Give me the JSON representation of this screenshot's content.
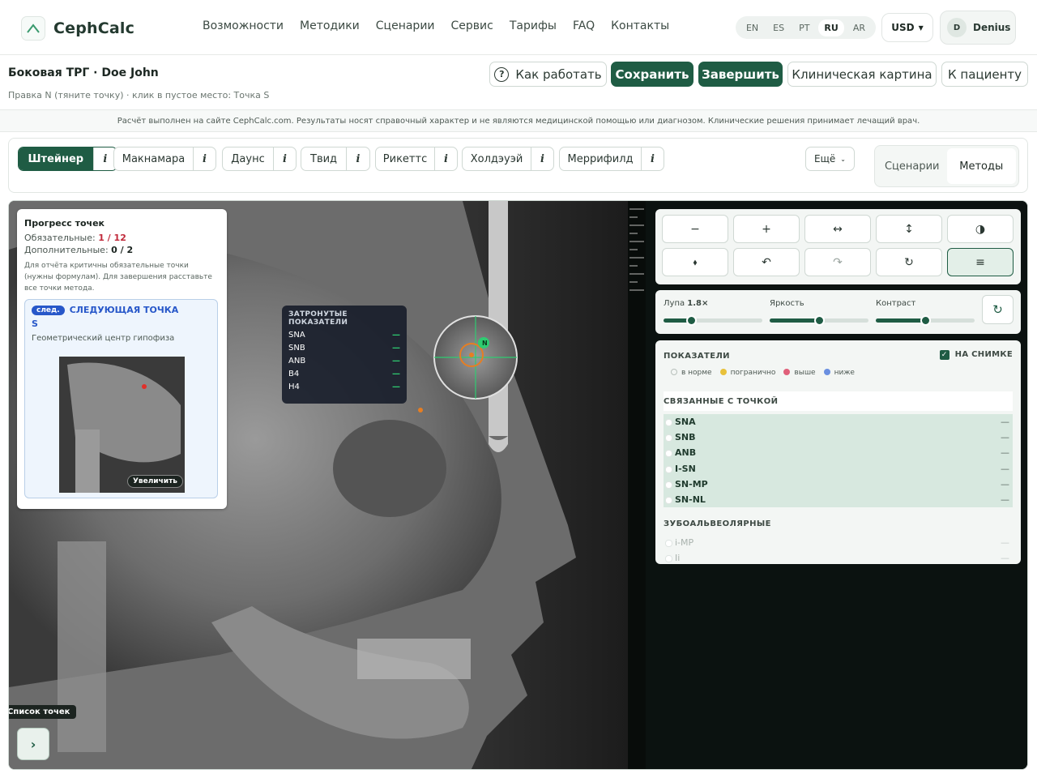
{
  "nav": {
    "brand": "CephCalc",
    "links": [
      "Возможности",
      "Методики",
      "Сценарии",
      "Сервис",
      "Тарифы",
      "FAQ",
      "Контакты"
    ],
    "languages": [
      "EN",
      "ES",
      "PT",
      "RU",
      "AR"
    ],
    "active_language": "RU",
    "currency": "USD",
    "user_initial": "D",
    "user_name": "Denius"
  },
  "header": {
    "title": "Боковая ТРГ · Doe John",
    "subtitle": "Правка N (тяните точку) · клик в пустое место: Точка S",
    "how_label": "Как работать",
    "save_label": "Сохранить",
    "finish_label": "Завершить",
    "clinical_label": "Клиническая картина",
    "patient_label": "К пациенту"
  },
  "disclaimer": "Расчёт выполнен на сайте CephCalc.com. Результаты носят справочный характер и не являются медицинской помощью или диагнозом. Клинические решения принимает лечащий врач.",
  "methods": {
    "items": [
      "Штейнер",
      "Макнамара",
      "Даунс",
      "Твид",
      "Рикеттс",
      "Холдэуэй",
      "Меррифилд"
    ],
    "active": "Штейнер",
    "info_glyph": "i",
    "more_label": "Ещё",
    "segments": [
      "Сценарии",
      "Методы"
    ],
    "active_segment": "Методы"
  },
  "progress": {
    "title": "Прогресс точек",
    "required_label": "Обязательные:",
    "required_value": "1 / 12",
    "optional_label": "Дополнительные:",
    "optional_value": "0 / 2",
    "note": "Для отчёта критичны обязательные точки (нужны формулам). Для завершения расставьте все точки метода.",
    "next_badge": "след.",
    "next_label": "СЛЕДУЮЩАЯ ТОЧКА",
    "next_point": "S",
    "next_desc": "Геометрический центр гипофиза",
    "enlarge_label": "Увеличить"
  },
  "affected": {
    "title": "ЗАТРОНУТЫЕ ПОКАЗАТЕЛИ",
    "items": [
      "SNA",
      "SNB",
      "ANB",
      "B4",
      "H4"
    ],
    "value": "—"
  },
  "point_marker": "N",
  "point_list": {
    "tooltip": "Список точек",
    "toggle_glyph": "›"
  },
  "tools": {
    "zoom_out": "−",
    "zoom_in": "+",
    "flip_h": "↔",
    "flip_v": "↕",
    "contrast": "◑",
    "move": "⬧",
    "undo": "↶",
    "redo": "↷",
    "reset": "↻",
    "settings": "≡"
  },
  "sliders": {
    "magnifier_label": "Лупа",
    "magnifier_value": "1.8×",
    "magnifier_level": 0.28,
    "brightness_label": "Яркость",
    "brightness_level": 0.5,
    "contrast_label": "Контраст",
    "contrast_level": 0.5,
    "reset_glyph": "↻"
  },
  "indicators": {
    "title": "ПОКАЗАТЕЛИ",
    "on_image_label": "НА СНИМКЕ",
    "legend": [
      {
        "label": "в норме",
        "color": "#ffffff"
      },
      {
        "label": "погранично",
        "color": "#e8c13a"
      },
      {
        "label": "выше",
        "color": "#e0607a"
      },
      {
        "label": "ниже",
        "color": "#6a8fe0"
      }
    ],
    "linked_title": "СВЯЗАННЫЕ С ТОЧКОЙ",
    "linked": [
      {
        "name": "SNA",
        "value": "—"
      },
      {
        "name": "SNB",
        "value": "—"
      },
      {
        "name": "ANB",
        "value": "—"
      },
      {
        "name": "I-SN",
        "value": "—"
      },
      {
        "name": "SN-MP",
        "value": "—"
      },
      {
        "name": "SN-NL",
        "value": "—"
      }
    ],
    "dental_title": "ЗУБОАЛЬВЕОЛЯРНЫЕ",
    "dental": [
      {
        "name": "i-MP",
        "value": "—"
      },
      {
        "name": "Ii",
        "value": "—"
      }
    ]
  },
  "colors": {
    "brand_green": "#1f5c44",
    "required_red": "#c0293a",
    "next_blue": "#2757c9"
  }
}
